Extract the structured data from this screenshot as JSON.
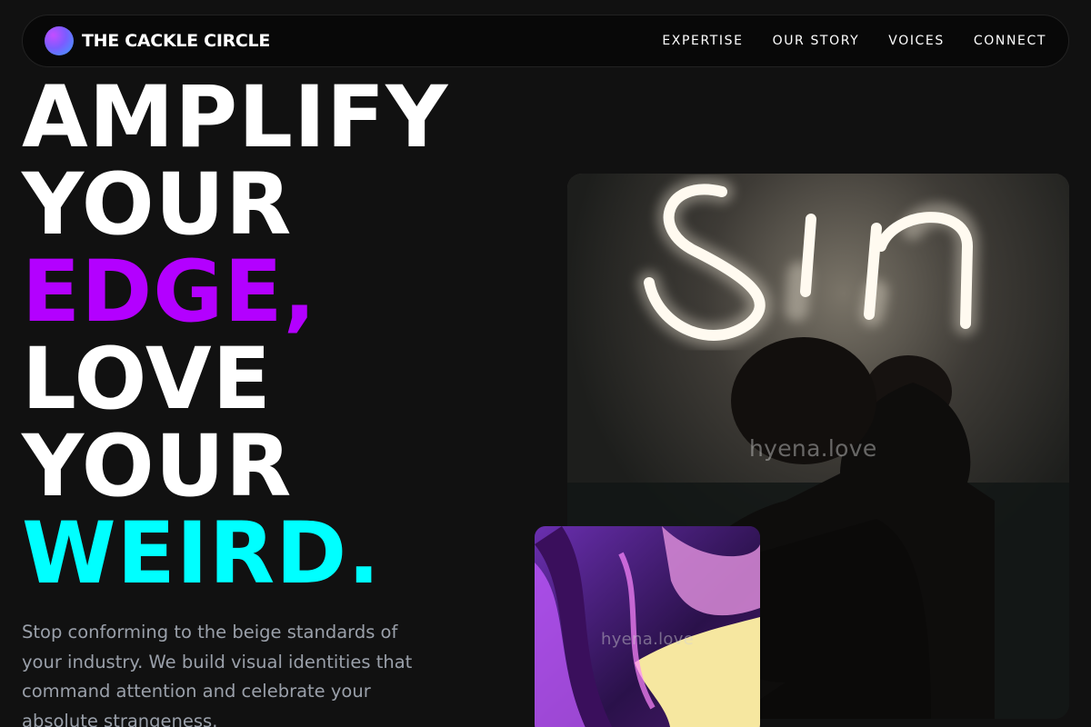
{
  "brand": {
    "name": "THE CACKLE CIRCLE",
    "logo_icon": "gradient-orb-icon"
  },
  "nav": {
    "items": [
      {
        "label": "EXPERTISE"
      },
      {
        "label": "OUR STORY"
      },
      {
        "label": "VOICES"
      },
      {
        "label": "CONNECT"
      }
    ]
  },
  "hero": {
    "lines": [
      {
        "text": "AMPLIFY",
        "color": "#ffffff"
      },
      {
        "text": "YOUR",
        "color": "#ffffff"
      },
      {
        "text": "EDGE,",
        "color": "#b300ff"
      },
      {
        "text": "LOVE",
        "color": "#ffffff"
      },
      {
        "text": "YOUR",
        "color": "#ffffff"
      },
      {
        "text": "WEIRD.",
        "color": "#00ffff"
      }
    ],
    "subtitle": "Stop conforming to the beige standards of your industry. We build visual identities that command attention and celebrate your absolute strangeness."
  },
  "images": {
    "main_watermark": "hyena.love",
    "secondary_watermark": "hyena.love"
  },
  "colors": {
    "background": "#111111",
    "accent_purple": "#b300ff",
    "accent_cyan": "#00ffff"
  }
}
